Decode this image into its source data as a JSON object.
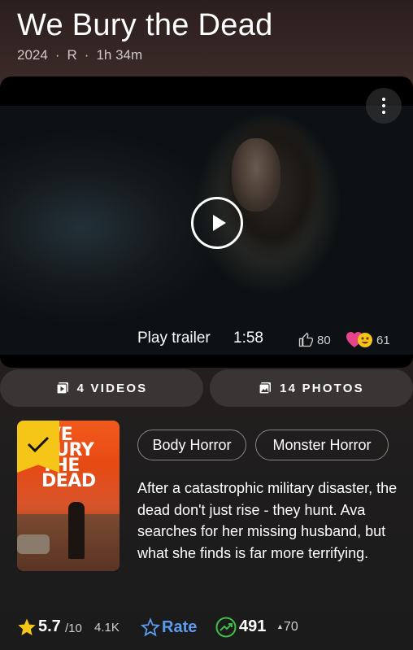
{
  "header": {
    "title": "We Bury the Dead",
    "year": "2024",
    "rating": "R",
    "runtime": "1h 34m"
  },
  "player": {
    "play_trailer_label": "Play trailer",
    "duration": "1:58",
    "likes": "80",
    "reactions": "61"
  },
  "media": {
    "videos_label": "4 VIDEOS",
    "photos_label": "14 PHOTOS"
  },
  "poster": {
    "title_text": "WE BURY THE DEAD",
    "watchlisted": true
  },
  "genres": [
    "Body Horror",
    "Monster Horror"
  ],
  "plot": "After a catastrophic military disaster, the dead don't just rise - they hunt. Ava searches for her missing husband, but what she finds is far more terrifying.",
  "ratings": {
    "score": "5.7",
    "out_of": "/10",
    "votes": "4.1K",
    "rate_label": "Rate",
    "popularity": "491",
    "popularity_change": "70"
  },
  "colors": {
    "accent_yellow": "#f5c518",
    "rate_blue": "#5b9bf0",
    "trend_green": "#3fbf4a"
  }
}
